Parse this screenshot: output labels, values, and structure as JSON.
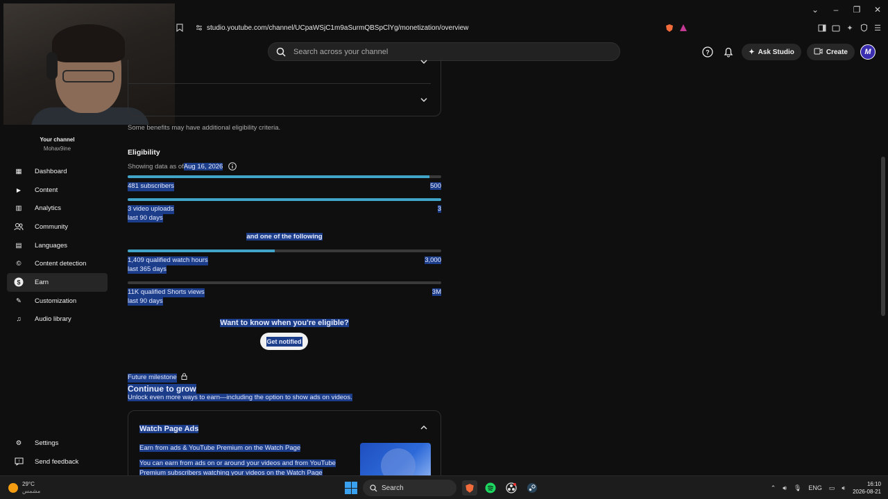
{
  "browser": {
    "url": "studio.youtube.com/channel/UCpaWSjC1m9aSurmQBSpClYg/monetization/overview",
    "window_controls": [
      "⌄",
      "–",
      "❐",
      "✕"
    ]
  },
  "header": {
    "search_placeholder": "Search across your channel",
    "ask_studio": "Ask Studio",
    "create": "Create",
    "avatar_letter": "M"
  },
  "sidebar": {
    "your_channel": "Your channel",
    "handle": "Mohax9ine",
    "items": [
      {
        "label": "Dashboard",
        "icon": "dashboard-icon",
        "glyph": "▦"
      },
      {
        "label": "Content",
        "icon": "content-icon",
        "glyph": "▶"
      },
      {
        "label": "Analytics",
        "icon": "analytics-icon",
        "glyph": "▥"
      },
      {
        "label": "Community",
        "icon": "community-icon",
        "glyph": "👥"
      },
      {
        "label": "Languages",
        "icon": "languages-icon",
        "glyph": "▤"
      },
      {
        "label": "Content detection",
        "icon": "copyright-icon",
        "glyph": "©"
      },
      {
        "label": "Earn",
        "icon": "earn-icon",
        "glyph": "$"
      },
      {
        "label": "Customization",
        "icon": "customization-icon",
        "glyph": "✎"
      },
      {
        "label": "Audio library",
        "icon": "audio-library-icon",
        "glyph": "♫"
      }
    ],
    "bottom": [
      {
        "label": "Settings",
        "icon": "settings-icon",
        "glyph": "⚙"
      },
      {
        "label": "Send feedback",
        "icon": "feedback-icon",
        "glyph": "!"
      }
    ]
  },
  "main": {
    "benefits_note": "Some benefits may have additional eligibility criteria.",
    "eligibility_title": "Eligibility",
    "showing_data_prefix": "Showing data as of ",
    "showing_data_date": "Aug 16, 2026",
    "metrics": [
      {
        "label": "481 subscribers",
        "sub": "",
        "target": "500",
        "progress": 0.962
      },
      {
        "label": "3 video uploads",
        "sub": "last 90 days",
        "target": "3",
        "progress": 1.0
      },
      {
        "label": "1,409 qualified watch hours",
        "sub": "last 365 days",
        "target": "3,000",
        "progress": 0.47
      },
      {
        "label": "11K qualified Shorts views",
        "sub": "last 90 days",
        "target": "3M",
        "progress": 0.0
      }
    ],
    "one_of_following": "and one of the following",
    "want_to_know": "Want to know when you're eligible?",
    "get_notified": "Get notified",
    "future_milestone": "Future milestone",
    "continue_to_grow": "Continue to grow",
    "unlock_text": "Unlock even more ways to earn—including the option to show ads on videos.",
    "ads_card": {
      "title": "Watch Page Ads",
      "subtitle": "Earn from ads & YouTube Premium on the Watch Page",
      "desc_line1": "You can earn from ads on or around your videos and from YouTube",
      "desc_line2": "Premium subscribers watching your videos on the Watch Page"
    }
  },
  "taskbar": {
    "temp": "29°C",
    "weather": "مشمس",
    "search": "Search",
    "lang": "ENG",
    "time": "16:10",
    "date": "2026-08-21"
  },
  "colors": {
    "accent_bar": "#41a5c9",
    "selection": "#1c3d8a",
    "background": "#0f0f0f"
  }
}
